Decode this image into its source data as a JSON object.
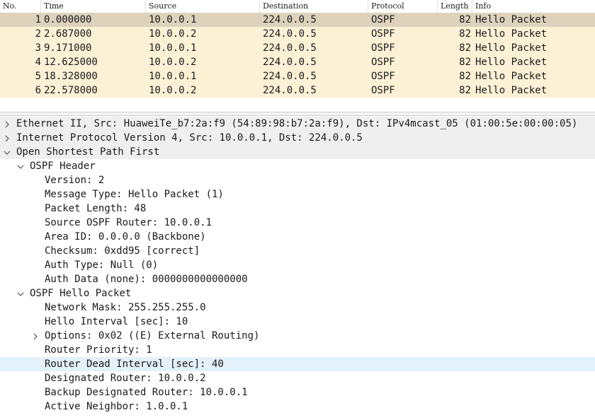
{
  "packet_list": {
    "columns": [
      "No.",
      "Time",
      "Source",
      "Destination",
      "Protocol",
      "Length",
      "Info"
    ],
    "rows": [
      {
        "no": "1",
        "time": "0.000000",
        "source": "10.0.0.1",
        "destination": "224.0.0.5",
        "protocol": "OSPF",
        "length": "82",
        "info": "Hello Packet"
      },
      {
        "no": "2",
        "time": "2.687000",
        "source": "10.0.0.2",
        "destination": "224.0.0.5",
        "protocol": "OSPF",
        "length": "82",
        "info": "Hello Packet"
      },
      {
        "no": "3",
        "time": "9.171000",
        "source": "10.0.0.1",
        "destination": "224.0.0.5",
        "protocol": "OSPF",
        "length": "82",
        "info": "Hello Packet"
      },
      {
        "no": "4",
        "time": "12.625000",
        "source": "10.0.0.2",
        "destination": "224.0.0.5",
        "protocol": "OSPF",
        "length": "82",
        "info": "Hello Packet"
      },
      {
        "no": "5",
        "time": "18.328000",
        "source": "10.0.0.1",
        "destination": "224.0.0.5",
        "protocol": "OSPF",
        "length": "82",
        "info": "Hello Packet"
      },
      {
        "no": "6",
        "time": "22.578000",
        "source": "10.0.0.2",
        "destination": "224.0.0.5",
        "protocol": "OSPF",
        "length": "82",
        "info": "Hello Packet"
      }
    ],
    "colors": {
      "row_bg": "#fdf1d5",
      "selected_bg": "#ddd3bd"
    }
  },
  "details": {
    "ethernet": "Ethernet II, Src: HuaweiTe_b7:2a:f9 (54:89:98:b7:2a:f9), Dst: IPv4mcast_05 (01:00:5e:00:00:05)",
    "ip": "Internet Protocol Version 4, Src: 10.0.0.1, Dst: 224.0.0.5",
    "ospf": "Open Shortest Path First",
    "ospf_header": {
      "title": "OSPF Header",
      "fields": [
        "Version: 2",
        "Message Type: Hello Packet (1)",
        "Packet Length: 48",
        "Source OSPF Router: 10.0.0.1",
        "Area ID: 0.0.0.0 (Backbone)",
        "Checksum: 0xdd95 [correct]",
        "Auth Type: Null (0)",
        "Auth Data (none): 0000000000000000"
      ]
    },
    "hello_packet": {
      "title": "OSPF Hello Packet",
      "network_mask": "Network Mask: 255.255.255.0",
      "hello_interval": "Hello Interval [sec]: 10",
      "options": "Options: 0x02 ((E) External Routing)",
      "router_priority": "Router Priority: 1",
      "dead_interval": "Router Dead Interval [sec]: 40",
      "designated_router": "Designated Router: 10.0.0.2",
      "backup_designated_router": "Backup Designated Router: 10.0.0.1",
      "active_neighbor": "Active Neighbor: 1.0.0.1"
    },
    "colors": {
      "top_bg": "#efefef",
      "highlight_bg": "#e4f0fa"
    }
  }
}
